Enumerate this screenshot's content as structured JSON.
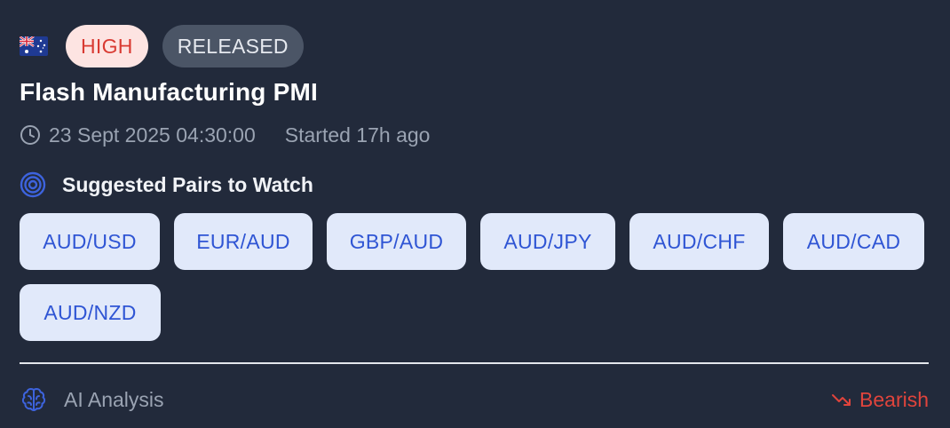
{
  "event": {
    "country_flag": "australia-flag-icon",
    "impact_label": "HIGH",
    "status_label": "RELEASED",
    "title": "Flash Manufacturing PMI",
    "datetime": "23 Sept 2025 04:30:00",
    "started": "Started 17h ago"
  },
  "suggested": {
    "heading": "Suggested Pairs to Watch",
    "pairs": [
      "AUD/USD",
      "EUR/AUD",
      "GBP/AUD",
      "AUD/JPY",
      "AUD/CHF",
      "AUD/CAD",
      "AUD/NZD"
    ]
  },
  "analysis": {
    "label": "AI Analysis",
    "sentiment": "Bearish"
  },
  "colors": {
    "background": "#222a3b",
    "high_badge_bg": "#fde4e2",
    "high_badge_text": "#d93a32",
    "released_badge_bg": "#4b5566",
    "pair_bg": "#e1e9fa",
    "pair_text": "#2f55d4",
    "accent_blue": "#3d63dd",
    "bearish": "#e0443c"
  }
}
